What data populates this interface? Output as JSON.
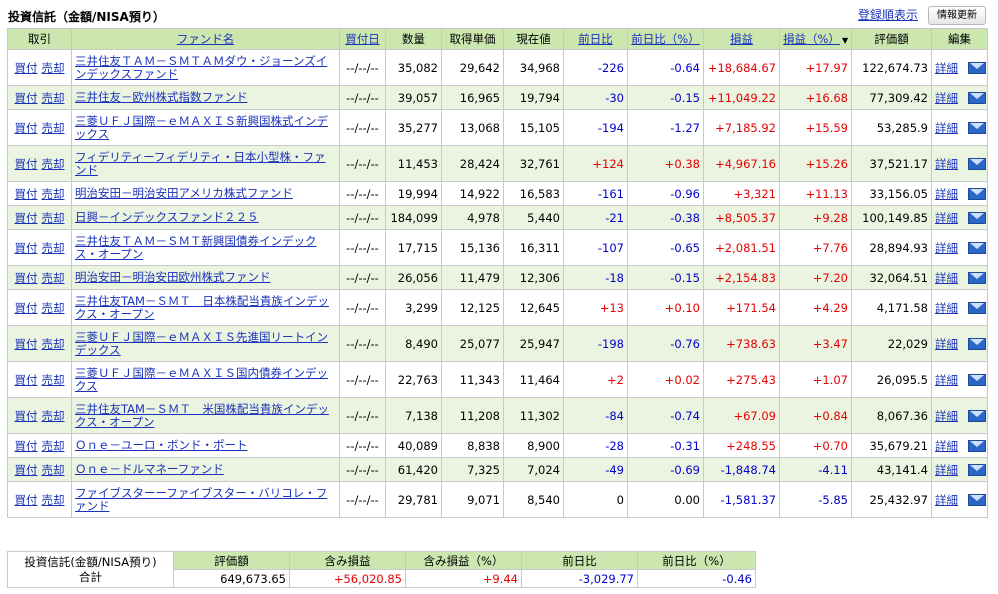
{
  "header": {
    "title": "投資信託（金額/NISA預り）",
    "sort_link": "登録順表示",
    "refresh_button": "情報更新"
  },
  "columns": [
    "取引",
    "ファンド名",
    "買付日",
    "数量",
    "取得単価",
    "現在値",
    "前日比",
    "前日比（%）",
    "損益",
    "損益（%）",
    "評価額",
    "編集"
  ],
  "sort_arrow": "▼",
  "actions": {
    "buy": "買付",
    "sell": "売却",
    "detail": "詳細"
  },
  "icons": {
    "mail": "mail-icon"
  },
  "colors": {
    "header_bg": "#cce6b0",
    "row_alt_bg": "#ebf4e0",
    "positive": "#e60000",
    "negative": "#0000cc",
    "link": "#1a33b8"
  },
  "rows": [
    {
      "fund": "三井住友ＴＡＭ－ＳＭＴＡＭダウ・ジョーンズインデックスファンド",
      "date": "--/--/--",
      "qty": "35,082",
      "cost": "29,642",
      "price": "34,968",
      "chg": "-226",
      "chg_pct": "-0.64",
      "pl": "+18,684.67",
      "pl_pct": "+17.97",
      "value": "122,674.73"
    },
    {
      "fund": "三井住友－欧州株式指数ファンド",
      "date": "--/--/--",
      "qty": "39,057",
      "cost": "16,965",
      "price": "19,794",
      "chg": "-30",
      "chg_pct": "-0.15",
      "pl": "+11,049.22",
      "pl_pct": "+16.68",
      "value": "77,309.42"
    },
    {
      "fund": "三菱ＵＦＪ国際－ｅＭＡＸＩＳ新興国株式インデックス",
      "date": "--/--/--",
      "qty": "35,277",
      "cost": "13,068",
      "price": "15,105",
      "chg": "-194",
      "chg_pct": "-1.27",
      "pl": "+7,185.92",
      "pl_pct": "+15.59",
      "value": "53,285.9"
    },
    {
      "fund": "フィデリティーフィデリティ・日本小型株・ファンド",
      "date": "--/--/--",
      "qty": "11,453",
      "cost": "28,424",
      "price": "32,761",
      "chg": "+124",
      "chg_pct": "+0.38",
      "pl": "+4,967.16",
      "pl_pct": "+15.26",
      "value": "37,521.17"
    },
    {
      "fund": "明治安田－明治安田アメリカ株式ファンド",
      "date": "--/--/--",
      "qty": "19,994",
      "cost": "14,922",
      "price": "16,583",
      "chg": "-161",
      "chg_pct": "-0.96",
      "pl": "+3,321",
      "pl_pct": "+11.13",
      "value": "33,156.05"
    },
    {
      "fund": "日興－インデックスファンド２２５",
      "date": "--/--/--",
      "qty": "184,099",
      "cost": "4,978",
      "price": "5,440",
      "chg": "-21",
      "chg_pct": "-0.38",
      "pl": "+8,505.37",
      "pl_pct": "+9.28",
      "value": "100,149.85"
    },
    {
      "fund": "三井住友ＴＡＭ－ＳＭＴ新興国債券インデックス・オープン",
      "date": "--/--/--",
      "qty": "17,715",
      "cost": "15,136",
      "price": "16,311",
      "chg": "-107",
      "chg_pct": "-0.65",
      "pl": "+2,081.51",
      "pl_pct": "+7.76",
      "value": "28,894.93"
    },
    {
      "fund": "明治安田－明治安田欧州株式ファンド",
      "date": "--/--/--",
      "qty": "26,056",
      "cost": "11,479",
      "price": "12,306",
      "chg": "-18",
      "chg_pct": "-0.15",
      "pl": "+2,154.83",
      "pl_pct": "+7.20",
      "value": "32,064.51"
    },
    {
      "fund": "三井住友TAM－ＳＭＴ　日本株配当貴族インデックス・オープン",
      "date": "--/--/--",
      "qty": "3,299",
      "cost": "12,125",
      "price": "12,645",
      "chg": "+13",
      "chg_pct": "+0.10",
      "pl": "+171.54",
      "pl_pct": "+4.29",
      "value": "4,171.58"
    },
    {
      "fund": "三菱ＵＦＪ国際－ｅＭＡＸＩＳ先進国リートインデックス",
      "date": "--/--/--",
      "qty": "8,490",
      "cost": "25,077",
      "price": "25,947",
      "chg": "-198",
      "chg_pct": "-0.76",
      "pl": "+738.63",
      "pl_pct": "+3.47",
      "value": "22,029"
    },
    {
      "fund": "三菱ＵＦＪ国際－ｅＭＡＸＩＳ国内債券インデックス",
      "date": "--/--/--",
      "qty": "22,763",
      "cost": "11,343",
      "price": "11,464",
      "chg": "+2",
      "chg_pct": "+0.02",
      "pl": "+275.43",
      "pl_pct": "+1.07",
      "value": "26,095.5"
    },
    {
      "fund": "三井住友TAM－ＳＭＴ　米国株配当貴族インデックス・オープン",
      "date": "--/--/--",
      "qty": "7,138",
      "cost": "11,208",
      "price": "11,302",
      "chg": "-84",
      "chg_pct": "-0.74",
      "pl": "+67.09",
      "pl_pct": "+0.84",
      "value": "8,067.36"
    },
    {
      "fund": "Ｏｎｅ－ユーロ・ボンド・ポート",
      "date": "--/--/--",
      "qty": "40,089",
      "cost": "8,838",
      "price": "8,900",
      "chg": "-28",
      "chg_pct": "-0.31",
      "pl": "+248.55",
      "pl_pct": "+0.70",
      "value": "35,679.21"
    },
    {
      "fund": "Ｏｎｅ－ドルマネーファンド",
      "date": "--/--/--",
      "qty": "61,420",
      "cost": "7,325",
      "price": "7,024",
      "chg": "-49",
      "chg_pct": "-0.69",
      "pl": "-1,848.74",
      "pl_pct": "-4.11",
      "value": "43,141.4"
    },
    {
      "fund": "ファイブスターーファイブスター・バリコレ・ファンド",
      "date": "--/--/--",
      "qty": "29,781",
      "cost": "9,071",
      "price": "8,540",
      "chg": "0",
      "chg_pct": "0.00",
      "pl": "-1,581.37",
      "pl_pct": "-5.85",
      "value": "25,432.97"
    }
  ],
  "summary": {
    "label_line1": "投資信託(金額/NISA預り)",
    "label_line2": "合計",
    "headers": [
      "評価額",
      "含み損益",
      "含み損益（%）",
      "前日比",
      "前日比（%）"
    ],
    "values": [
      "649,673.65",
      "+56,020.85",
      "+9.44",
      "-3,029.77",
      "-0.46"
    ]
  }
}
